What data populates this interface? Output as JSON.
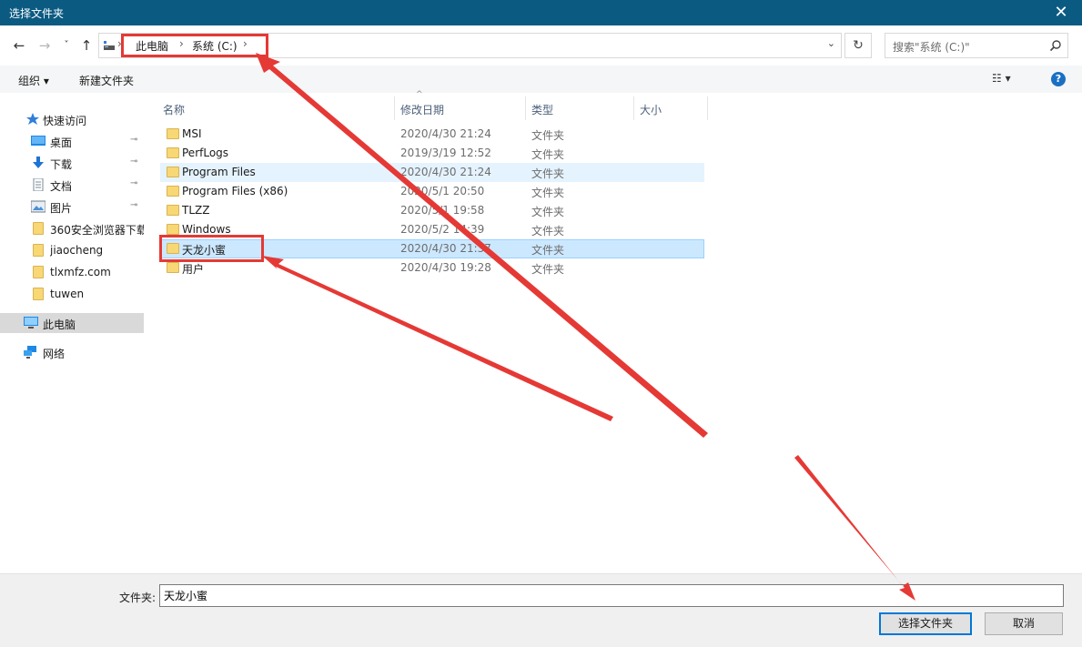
{
  "window": {
    "title": "选择文件夹",
    "close_glyph": "✕"
  },
  "nav": {
    "back_glyph": "←",
    "forward_glyph": "→",
    "recent_glyph": "˅",
    "up_glyph": "↑",
    "breadcrumb": [
      "此电脑",
      "系统 (C:)"
    ],
    "sep_glyph": "›",
    "dropdown_glyph": "⌄",
    "refresh_glyph": "↻",
    "search_placeholder": "搜索\"系统 (C:)\""
  },
  "toolbar": {
    "organize": "组织 ▾",
    "new_folder": "新建文件夹",
    "view_glyph": "☷ ▾",
    "help_glyph": "?"
  },
  "sidebar": {
    "quick_access": "快速访问",
    "items": [
      {
        "label": "桌面",
        "icon": "desktop-icon",
        "pinned": true
      },
      {
        "label": "下载",
        "icon": "download-icon",
        "pinned": true
      },
      {
        "label": "文档",
        "icon": "document-icon",
        "pinned": true
      },
      {
        "label": "图片",
        "icon": "pictures-icon",
        "pinned": true
      },
      {
        "label": "360安全浏览器下载",
        "icon": "folder-icon",
        "pinned": false
      },
      {
        "label": "jiaocheng",
        "icon": "folder-icon",
        "pinned": false
      },
      {
        "label": "tlxmfz.com",
        "icon": "folder-icon",
        "pinned": false
      },
      {
        "label": "tuwen",
        "icon": "folder-icon",
        "pinned": false
      }
    ],
    "this_pc": "此电脑",
    "network": "网络",
    "pin_glyph": "📌"
  },
  "columns": {
    "name": "名称",
    "date": "修改日期",
    "type": "类型",
    "size": "大小",
    "sort_glyph": "^"
  },
  "files": [
    {
      "name": "MSI",
      "date": "2020/4/30 21:24",
      "type": "文件夹"
    },
    {
      "name": "PerfLogs",
      "date": "2019/3/19 12:52",
      "type": "文件夹"
    },
    {
      "name": "Program Files",
      "date": "2020/4/30 21:24",
      "type": "文件夹"
    },
    {
      "name": "Program Files (x86)",
      "date": "2020/5/1 20:50",
      "type": "文件夹"
    },
    {
      "name": "TLZZ",
      "date": "2020/5/1 19:58",
      "type": "文件夹"
    },
    {
      "name": "Windows",
      "date": "2020/5/2 14:39",
      "type": "文件夹"
    },
    {
      "name": "天龙小蜜",
      "date": "2020/4/30 21:37",
      "type": "文件夹"
    },
    {
      "name": "用户",
      "date": "2020/4/30 19:28",
      "type": "文件夹"
    }
  ],
  "footer": {
    "folder_label": "文件夹:",
    "folder_value": "天龙小蜜",
    "select_button": "选择文件夹",
    "cancel_button": "取消"
  },
  "colors": {
    "titlebar": "#0b5a82",
    "selection": "#cce8ff",
    "hover": "#e5f3ff",
    "annotation": "#e53935"
  }
}
